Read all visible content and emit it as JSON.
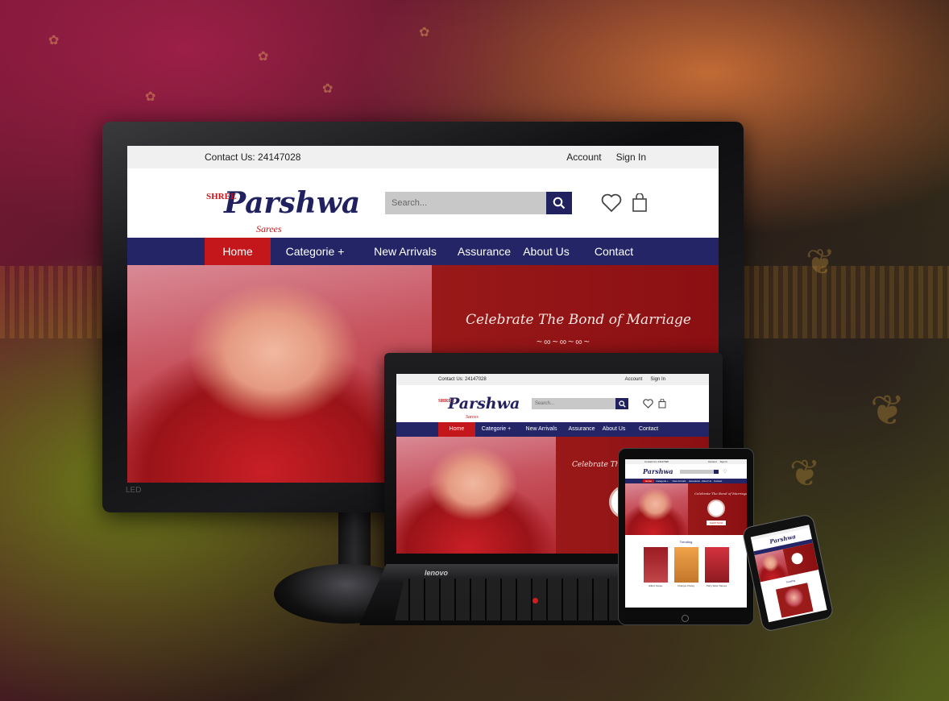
{
  "site": {
    "topbar": {
      "contact": "Contact Us: 24147028",
      "account": "Account",
      "sign_in": "Sign In"
    },
    "logo": {
      "shree": "SHREE",
      "main": "Parshwa",
      "sarees": "Sarees"
    },
    "search": {
      "placeholder": "Search..."
    },
    "nav": [
      "Home",
      "Categorie +",
      "New Arrivals",
      "Assurance",
      "About Us",
      "Contact"
    ],
    "hero": {
      "tagline": "Celebrate The Bond of Marriage"
    }
  },
  "laptop": {
    "brand": "lenovo"
  },
  "tablet": {
    "trending_title": "Trending",
    "products": [
      "Gillam Saree",
      "Chaniya Choley",
      "Party Wear Sarees"
    ],
    "shop_label": "SHOP NOW"
  },
  "phone": {
    "trending_title": "Trending"
  },
  "icons": [
    "search-icon",
    "heart-icon",
    "shopping-bag-icon"
  ],
  "colors": {
    "navy": "#232566",
    "red": "#c3171b",
    "topbar": "#f0f0f0"
  }
}
